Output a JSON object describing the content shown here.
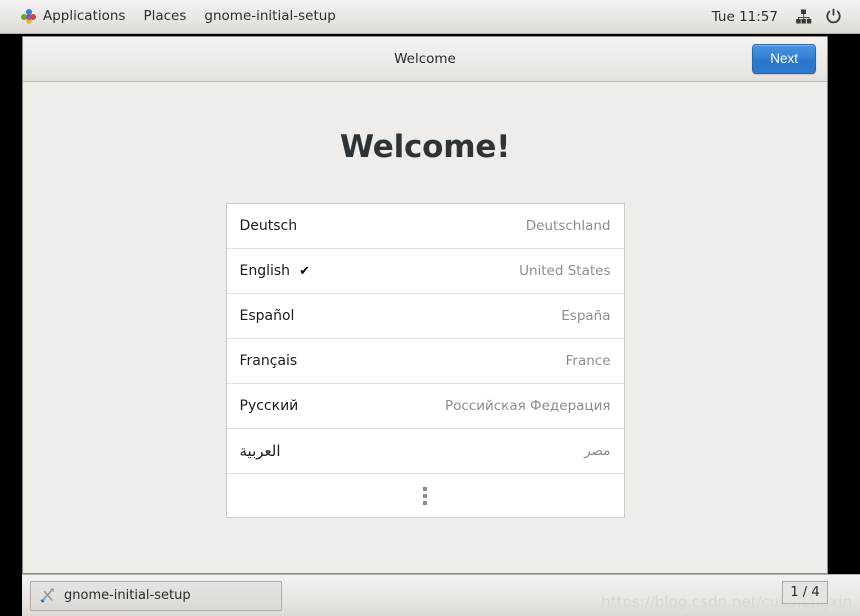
{
  "top_panel": {
    "applications_label": "Applications",
    "places_label": "Places",
    "window_menu_label": "gnome-initial-setup",
    "clock": "Tue 11:57",
    "network_icon": "network-wired-icon",
    "power_icon": "power-icon",
    "apps_icon": "applications-pinwheel-icon"
  },
  "window": {
    "title": "Welcome",
    "next_label": "Next",
    "heading": "Welcome!"
  },
  "languages": [
    {
      "name": "Deutsch",
      "country": "Deutschland",
      "selected": false,
      "rtl": false
    },
    {
      "name": "English",
      "country": "United States",
      "selected": true,
      "rtl": false
    },
    {
      "name": "Español",
      "country": "España",
      "selected": false,
      "rtl": false
    },
    {
      "name": "Français",
      "country": "France",
      "selected": false,
      "rtl": false
    },
    {
      "name": "Русский",
      "country": "Российская Федерация",
      "selected": false,
      "rtl": false
    },
    {
      "name": "العربية",
      "country": "مصر",
      "selected": false,
      "rtl": true
    }
  ],
  "check_glyph": "✔",
  "more_row": {
    "icon": "vertical-dots-icon"
  },
  "taskbar": {
    "task_label": "gnome-initial-setup",
    "task_icon": "tools-icon",
    "workspace_indicator": "1 / 4",
    "watermark": "https://blog.csdn.net/cuichongxin"
  },
  "colors": {
    "accent_blue": "#3280d6",
    "panel_bg": "#e9e7e4",
    "window_bg": "#efedea",
    "list_bg": "#ffffff",
    "country_text": "#8f8d8a",
    "heading_text": "#2e3436"
  }
}
